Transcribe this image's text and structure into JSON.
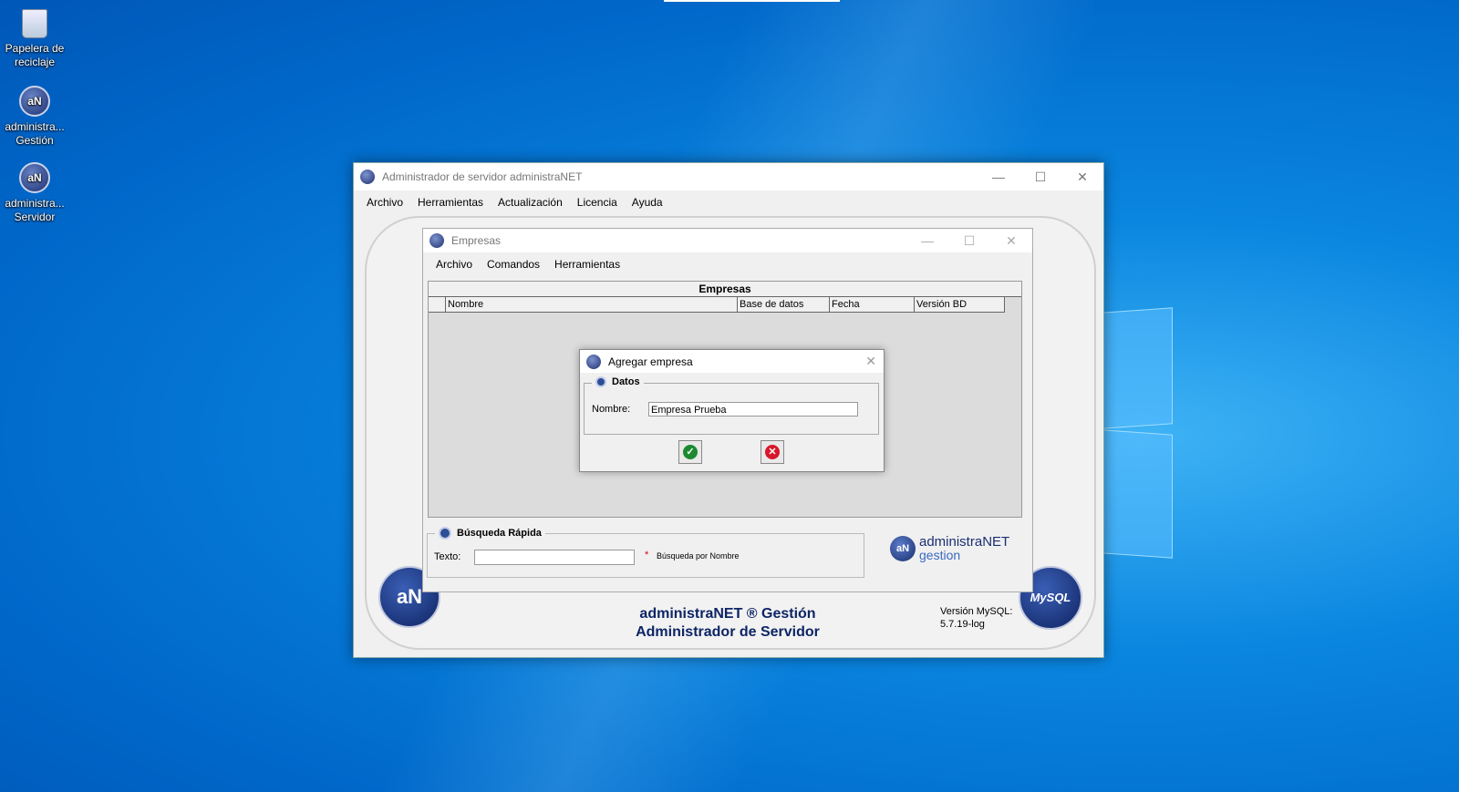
{
  "desktop": {
    "icons": [
      {
        "label": "Papelera de reciclaje"
      },
      {
        "label": "administra... Gestión"
      },
      {
        "label": "administra... Servidor"
      }
    ]
  },
  "main_window": {
    "title": "Administrador de servidor administraNET",
    "menu": [
      "Archivo",
      "Herramientas",
      "Actualización",
      "Licencia",
      "Ayuda"
    ],
    "brand_line1": "administraNET ® Gestión",
    "brand_line2": "Administrador de Servidor",
    "version_label": "Versión MySQL:",
    "version_value": "5.7.19-log",
    "logo_left_text": "aN",
    "logo_right_text": "MySQL"
  },
  "empresas_window": {
    "title": "Empresas",
    "menu": [
      "Archivo",
      "Comandos",
      "Herramientas"
    ],
    "grid_title": "Empresas",
    "columns": [
      "Nombre",
      "Base de datos",
      "Fecha",
      "Versión BD"
    ],
    "search": {
      "legend": "Búsqueda Rápida",
      "label": "Texto:",
      "value": "",
      "asterisk": "*",
      "hint": "Búsqueda por Nombre"
    },
    "logo": {
      "mark": "aN",
      "line1": "administraNET",
      "line2": "gestion"
    }
  },
  "dialog": {
    "title": "Agregar empresa",
    "legend": "Datos",
    "name_label": "Nombre:",
    "name_value": "Empresa Prueba",
    "ok_icon": "check-icon",
    "cancel_icon": "cancel-icon"
  }
}
